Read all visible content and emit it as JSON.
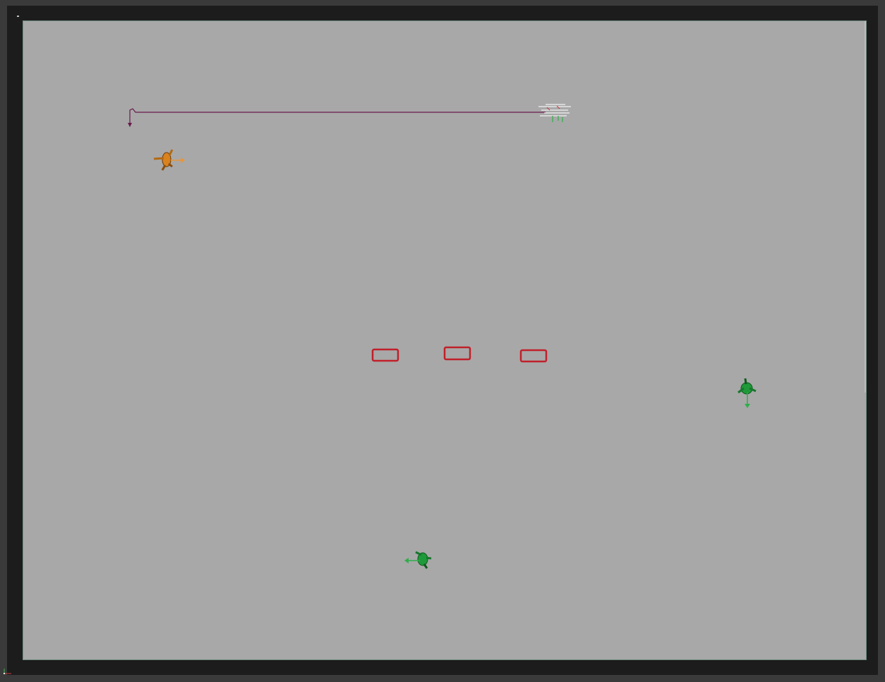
{
  "viewport": {
    "background_color": "#a8a8a8",
    "frame_color": "#1c1c1c",
    "border_color": "#6e8a80"
  },
  "scene": {
    "characters": [
      {
        "id": "orange-character",
        "color": "#d9821e",
        "facing": "right"
      },
      {
        "id": "green-character-right",
        "color": "#1f9a3a",
        "facing": "down"
      },
      {
        "id": "green-character-bottom",
        "color": "#1f9a3a",
        "facing": "left"
      }
    ],
    "boxes": [
      {
        "id": "box-1",
        "color": "#c0202a"
      },
      {
        "id": "box-2",
        "color": "#c0202a"
      },
      {
        "id": "box-3",
        "color": "#c0202a"
      }
    ],
    "path_line": {
      "color": "#6a1a4a"
    }
  },
  "icons": {
    "viewport_axis": "axis-gizmo-icon",
    "corner_marker": "corner-marker-icon"
  }
}
